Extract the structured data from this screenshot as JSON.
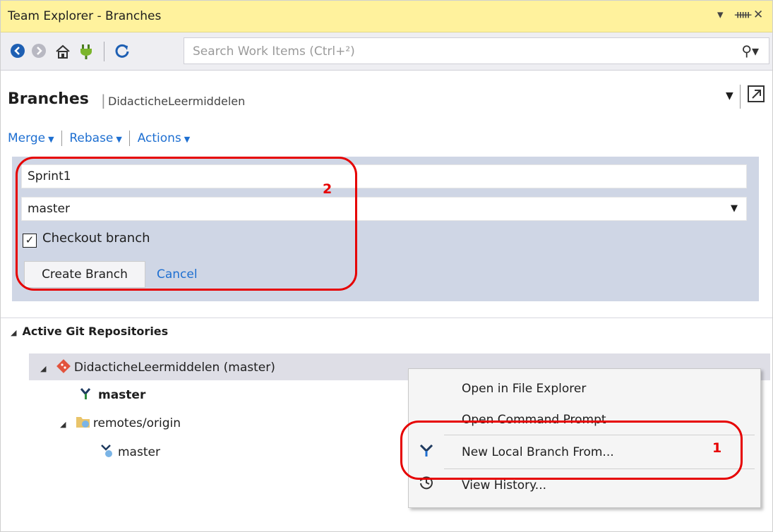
{
  "window": {
    "title": "Team Explorer - Branches",
    "controls": [
      "▾",
      "ᚔ",
      "✕"
    ]
  },
  "toolbar": {
    "search_placeholder": "Search Work Items (Ctrl+²)"
  },
  "header": {
    "title": "Branches",
    "separator": "|",
    "repo": "DidacticheLeermiddelen"
  },
  "actions": {
    "merge": "Merge",
    "rebase": "Rebase",
    "actions": "Actions"
  },
  "create_branch": {
    "name_value": "Sprint1",
    "source_value": "master",
    "checkout_label": "Checkout branch",
    "create_label": "Create Branch",
    "cancel_label": "Cancel"
  },
  "tree": {
    "section_label": "Active Git Repositories",
    "repo_label": "DidacticheLeermiddelen (master)",
    "local_branch": "master",
    "remote_folder": "remotes/origin",
    "remote_branch": "master"
  },
  "context_menu": {
    "items": [
      "Open in File Explorer",
      "Open Command Prompt",
      "New Local Branch From...",
      "View History..."
    ]
  },
  "annotations": {
    "label_1": "1",
    "label_2": "2"
  },
  "colors": {
    "accent": "#1e6fd1",
    "annotation": "#e60000",
    "titlebar": "#fff29d"
  }
}
